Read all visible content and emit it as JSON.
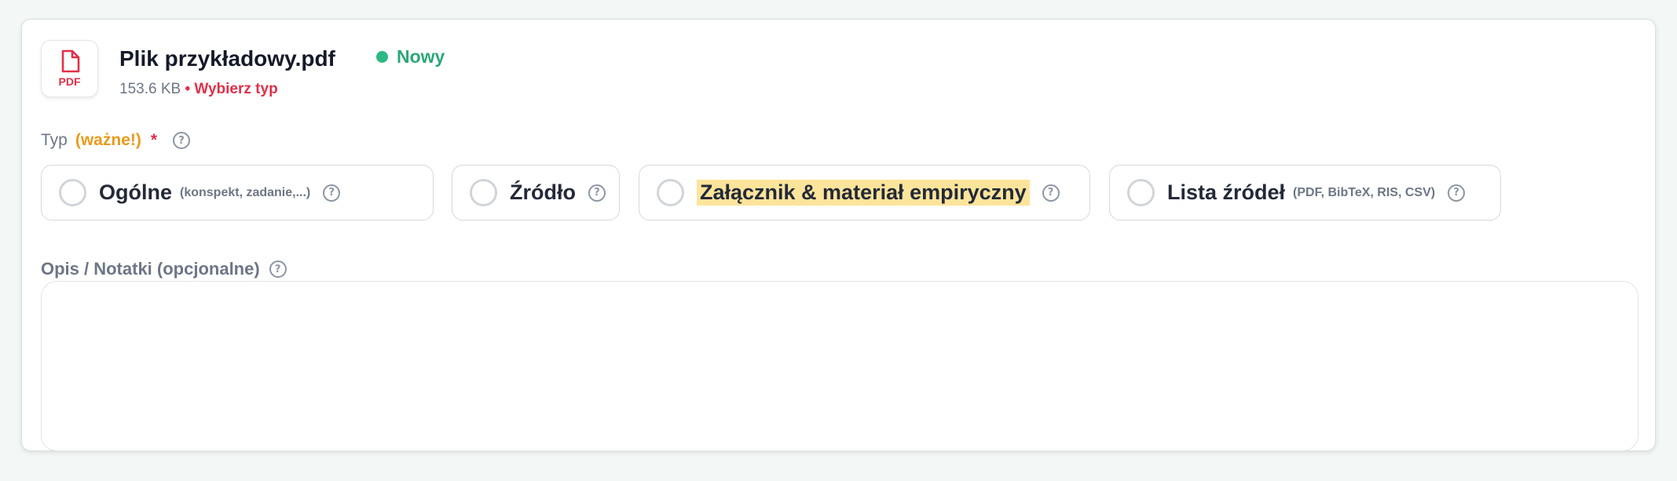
{
  "file": {
    "icon_label": "PDF",
    "name": "Plik przykładowy.pdf",
    "status": "Nowy",
    "size": "153.6 KB",
    "separator": "•",
    "type_warning": "Wybierz typ"
  },
  "type_field": {
    "label": "Typ",
    "important": "(ważne!)",
    "required_mark": "*",
    "options": [
      {
        "label": "Ogólne",
        "hint": "(konspekt, zadanie,...)",
        "selected": false
      },
      {
        "label": "Źródło",
        "hint": "",
        "selected": false
      },
      {
        "label": "Załącznik & materiał empiryczny",
        "hint": "",
        "selected": false,
        "highlighted": true
      },
      {
        "label": "Lista źródeł",
        "hint": "(PDF, BibTeX, RIS, CSV)",
        "selected": false
      }
    ]
  },
  "description_field": {
    "label": "Opis / Notatki (opcjonalne)",
    "value": "",
    "placeholder": ""
  },
  "colors": {
    "accent_green": "#2fb884",
    "warning_red": "#e0304a",
    "important_orange": "#ea9a1c",
    "highlight_yellow": "#fde49b"
  },
  "icons": {
    "file": "pdf-file-icon",
    "status": "status-dot-icon",
    "help": "question-circle-icon",
    "radio": "radio-empty-icon"
  }
}
